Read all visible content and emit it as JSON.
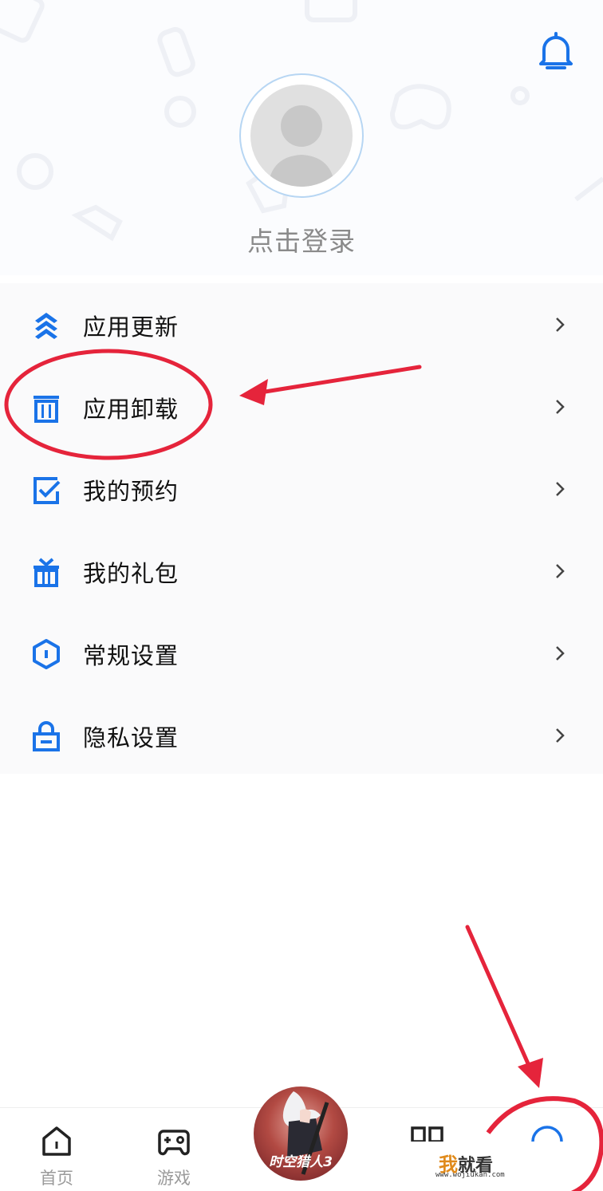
{
  "header": {
    "login_label": "点击登录"
  },
  "menu": {
    "items": [
      {
        "label": "应用更新",
        "icon": "update-layers-icon"
      },
      {
        "label": "应用卸载",
        "icon": "trash-icon"
      },
      {
        "label": "我的预约",
        "icon": "checklist-icon"
      },
      {
        "label": "我的礼包",
        "icon": "gift-icon"
      },
      {
        "label": "常规设置",
        "icon": "settings-hexagon-icon"
      },
      {
        "label": "隐私设置",
        "icon": "lock-icon"
      }
    ]
  },
  "bottom_nav": {
    "home_label": "首页",
    "games_label": "游戏",
    "featured_game_text": "时空猎人3"
  },
  "watermark": {
    "text_wo": "我",
    "text_rest": "就看",
    "url": "www.wojiukan.com"
  },
  "colors": {
    "accent": "#1a73e8",
    "annotation": "#e5243b",
    "label_gray": "#9a9a9a"
  }
}
